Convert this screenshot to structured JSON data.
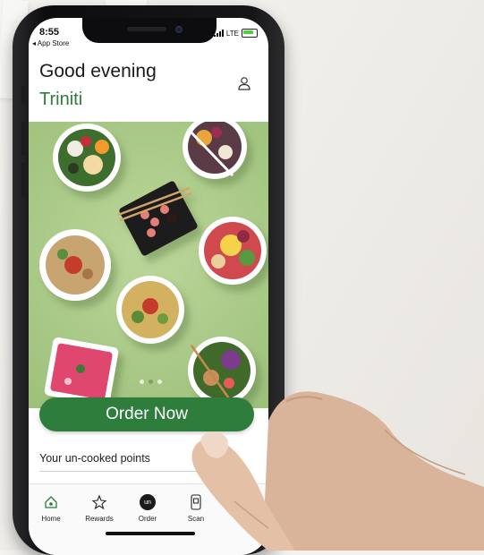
{
  "status_bar": {
    "time": "8:55",
    "back_link": "◂ App Store",
    "network": "LTE"
  },
  "header": {
    "greeting": "Good evening",
    "user_name": "Triniti"
  },
  "hero": {
    "carousel_pages": 3,
    "active_page": 2
  },
  "order_button": {
    "label": "Order Now"
  },
  "points_section": {
    "label": "Your un-cooked points"
  },
  "tab_bar": {
    "items": [
      {
        "label": "Home",
        "icon": "home-icon"
      },
      {
        "label": "Rewards",
        "icon": "rewards-icon"
      },
      {
        "label": "Order",
        "icon": "order-icon",
        "badge": "un"
      },
      {
        "label": "Scan",
        "icon": "scan-icon"
      }
    ]
  },
  "colors": {
    "brand_green": "#2f7d3c",
    "name_green": "#2f7a3d",
    "hero_bg": "#a9c987"
  }
}
